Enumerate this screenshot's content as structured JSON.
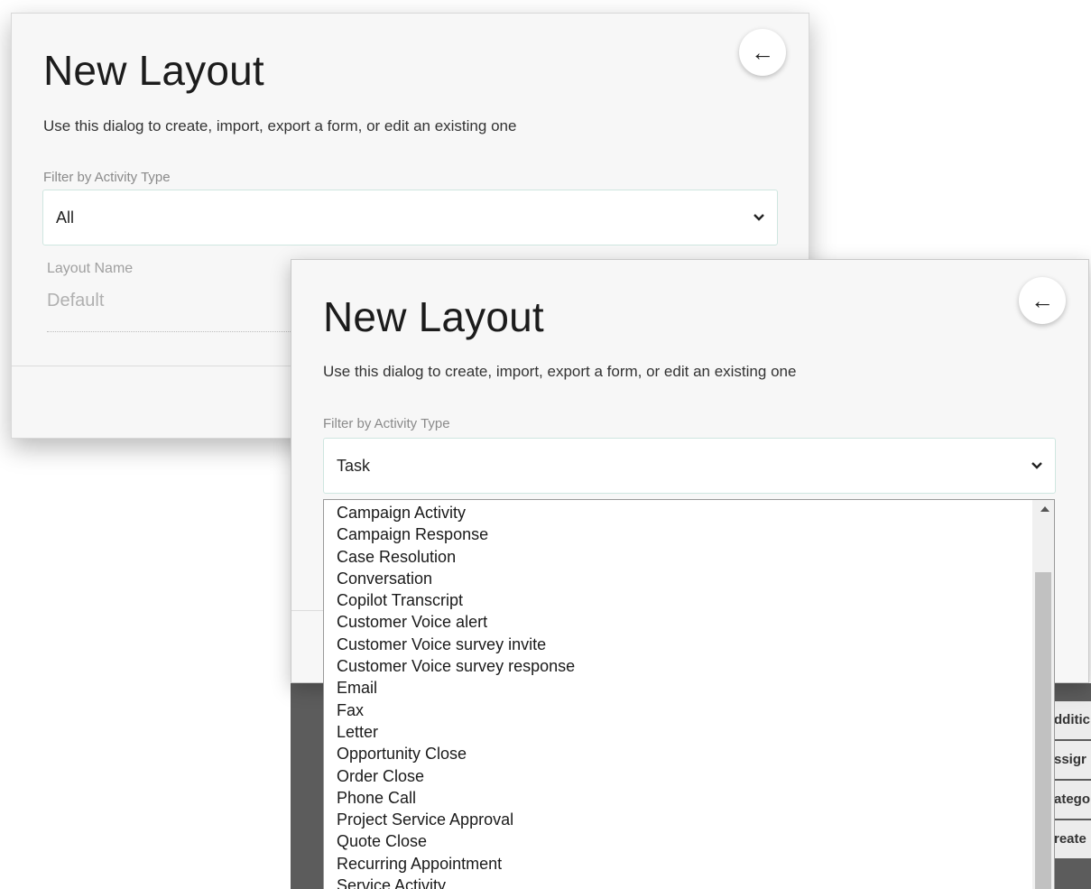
{
  "back_dialog": {
    "title": "New Layout",
    "subtitle": "Use this dialog to create, import, export a form, or edit an existing one",
    "filter_label": "Filter by Activity Type",
    "filter_value": "All",
    "layout_name_label": "Layout Name",
    "layout_name_value": "Default",
    "back_icon": "←"
  },
  "front_dialog": {
    "title": "New Layout",
    "subtitle": "Use this dialog to create, import, export a form, or edit an existing one",
    "filter_label": "Filter by Activity Type",
    "filter_value": "Task",
    "back_icon": "←",
    "dropdown_options": [
      "Campaign Activity",
      "Campaign Response",
      "Case Resolution",
      "Conversation",
      "Copilot Transcript",
      "Customer Voice alert",
      "Customer Voice survey invite",
      "Customer Voice survey response",
      "Email",
      "Fax",
      "Letter",
      "Opportunity Close",
      "Order Close",
      "Phone Call",
      "Project Service Approval",
      "Quote Close",
      "Recurring Appointment",
      "Service Activity"
    ]
  },
  "background_table": {
    "cells": [
      "dditic",
      "ssigr",
      "atego",
      "reate"
    ]
  }
}
